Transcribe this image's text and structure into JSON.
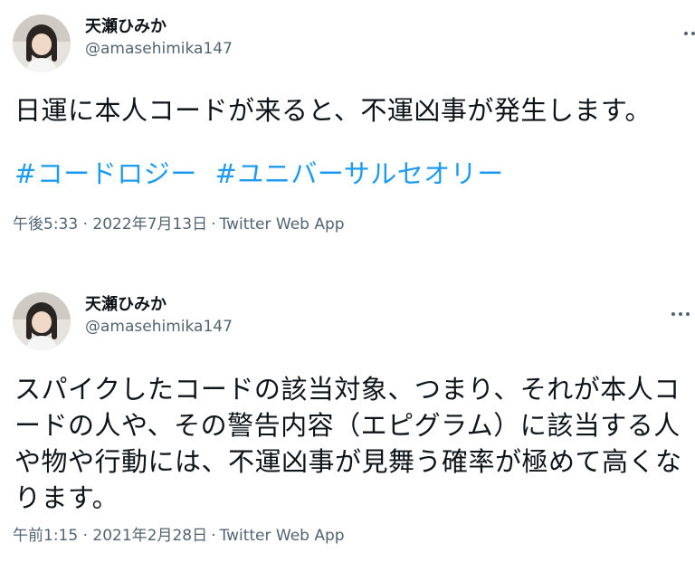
{
  "tweets": [
    {
      "author": {
        "display_name": "天瀬ひみか",
        "handle": "@amasehimika147"
      },
      "text": "日運に本人コードが来ると、不運凶事が発生します。",
      "hashtags": [
        "#コードロジー",
        "#ユニバーサルセオリー"
      ],
      "timestamp": "午後5:33 · 2022年7月13日",
      "separator": "·",
      "source": "Twitter Web App",
      "more_icon": "more-horizontal-icon"
    },
    {
      "author": {
        "display_name": "天瀬ひみか",
        "handle": "@amasehimika147"
      },
      "text": "スパイクしたコードの該当対象、つまり、それが本人コードの人や、その警告内容（エピグラム）に該当する人や物や行動には、不運凶事が見舞う確率が極めて高くなります。",
      "timestamp": "午前1:15 · 2021年2月28日",
      "separator": "·",
      "source": "Twitter Web App",
      "more_icon": "more-horizontal-icon"
    }
  ],
  "colors": {
    "text_primary": "#0f1419",
    "text_secondary": "#536471",
    "link": "#1d9bf0",
    "background": "#ffffff"
  }
}
